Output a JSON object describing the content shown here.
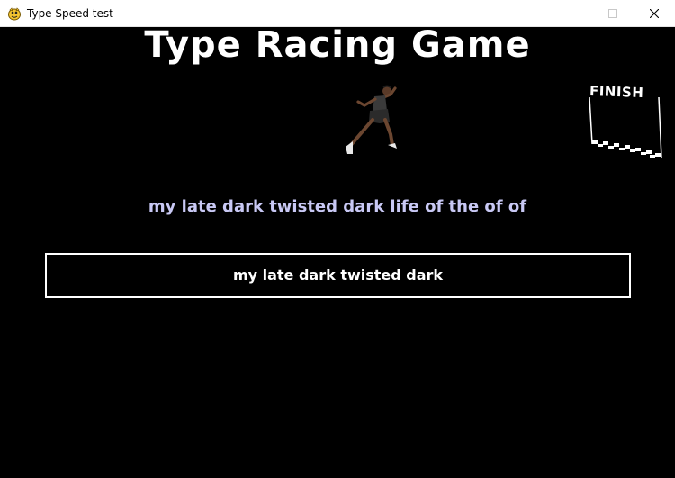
{
  "window": {
    "title": "Type Speed test",
    "app_icon": "pygame-snake-icon",
    "controls": [
      "minimize-icon",
      "maximize-icon",
      "close-icon"
    ]
  },
  "game": {
    "title": "Type Racing Game",
    "runner_icon": "runner-sprite",
    "finish_label": "FINISH",
    "target_sentence": "my late dark twisted dark life of the of of",
    "typed_input": "my late dark twisted dark"
  },
  "colors": {
    "background": "#000000",
    "title_text": "#ffffff",
    "target_text": "#c8c8f4",
    "input_border": "#ffffff",
    "input_text": "#ffffff"
  }
}
